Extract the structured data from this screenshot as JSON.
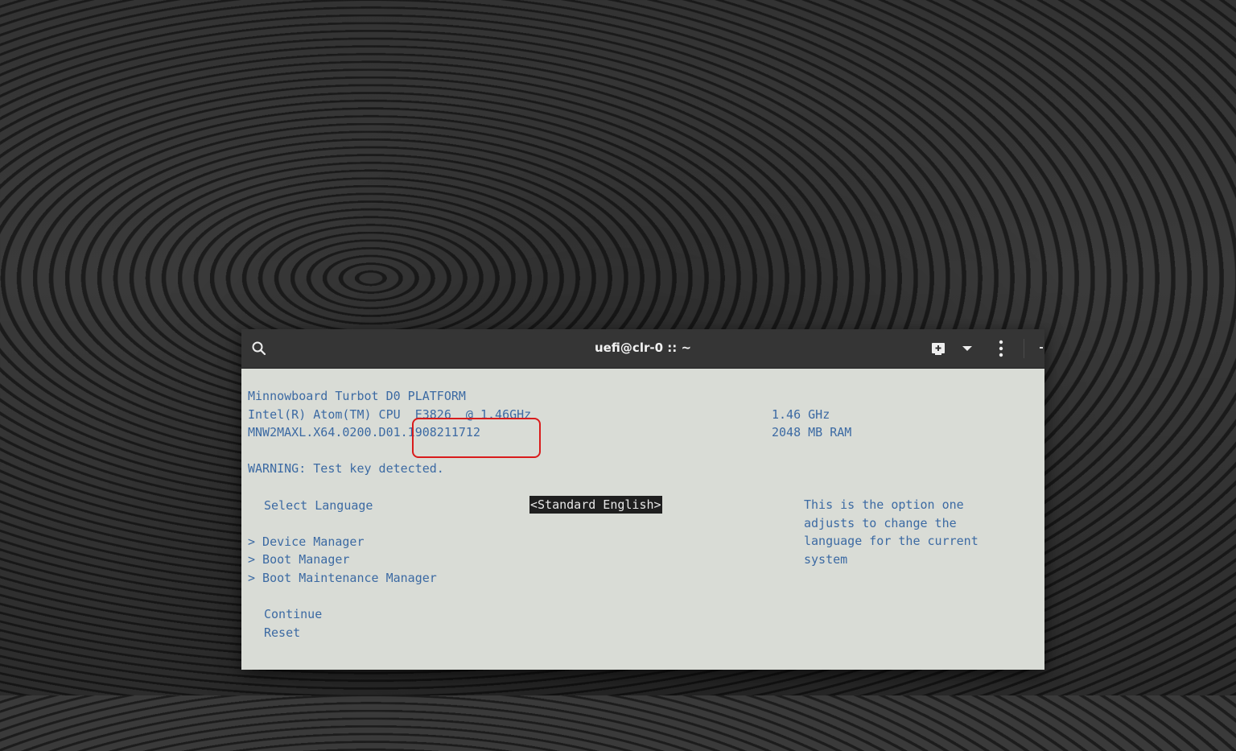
{
  "window": {
    "title": "uefi@clr-0 :: ~",
    "icons": [
      "search-icon",
      "new-tab-icon",
      "chevron-down-icon",
      "kebab-menu-icon"
    ]
  },
  "bios": {
    "platform_line": "Minnowboard Turbot D0 PLATFORM",
    "cpu_line": "Intel(R) Atom(TM) CPU  E3826  @ 1.46GHz",
    "cpu_speed": "1.46 GHz",
    "firmware_line": "MNW2MAXL.X64.0200.D01.1908211712",
    "ram": "2048 MB RAM",
    "warning": "WARNING: Test key detected.",
    "language_label": "Select Language",
    "language_value": "<Standard English>",
    "help_text": "This is the option one adjusts to change the language for the current system",
    "menu": [
      "> Device Manager",
      "> Boot Manager",
      "> Boot Maintenance Manager"
    ],
    "continue": "Continue",
    "reset": "Reset"
  },
  "colors": {
    "terminal_bg": "#d9dcd6",
    "terminal_text": "#3c6aa3",
    "titlebar": "#353535",
    "annotation": "#d91c1c"
  }
}
